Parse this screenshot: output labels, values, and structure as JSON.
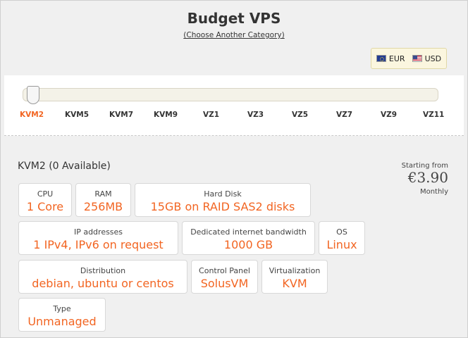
{
  "header": {
    "title": "Budget VPS",
    "category_link": "(Choose Another Category)"
  },
  "currency": {
    "options": [
      {
        "code": "EUR",
        "flag": "eu-flag-icon"
      },
      {
        "code": "USD",
        "flag": "us-flag-icon"
      }
    ],
    "selected": "EUR"
  },
  "slider": {
    "selected": "KVM2",
    "plans": [
      "KVM2",
      "KVM5",
      "KVM7",
      "KVM9",
      "VZ1",
      "VZ3",
      "VZ5",
      "VZ7",
      "VZ9",
      "VZ11"
    ]
  },
  "plan": {
    "name": "KVM2 (0 Available)",
    "price_label": "Starting from",
    "price": "€3.90",
    "period": "Monthly"
  },
  "specs": [
    {
      "label": "CPU",
      "value": "1 Core"
    },
    {
      "label": "RAM",
      "value": "256MB"
    },
    {
      "label": "Hard Disk",
      "value": "15GB on RAID SAS2 disks"
    },
    {
      "label": "IP addresses",
      "value": "1 IPv4, IPv6 on request"
    },
    {
      "label": "Dedicated internet bandwidth",
      "value": "1000 GB"
    },
    {
      "label": "OS",
      "value": "Linux"
    },
    {
      "label": "Distribution",
      "value": "debian, ubuntu or centos"
    },
    {
      "label": "Control Panel",
      "value": "SolusVM"
    },
    {
      "label": "Virtualization",
      "value": "KVM"
    },
    {
      "label": "Type",
      "value": "Unmanaged"
    }
  ],
  "colors": {
    "accent": "#f26522",
    "text": "#333333",
    "background": "#f0f0f0"
  }
}
